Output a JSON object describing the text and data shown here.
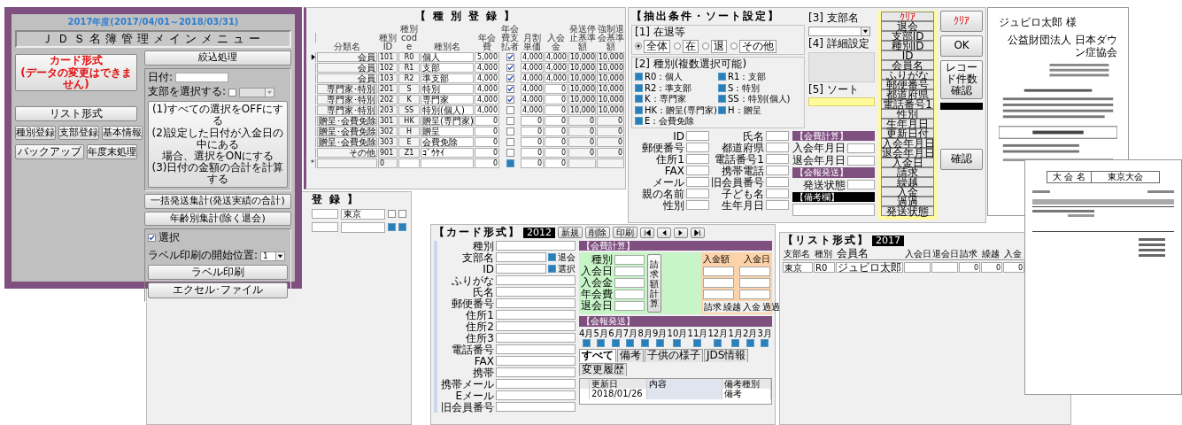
{
  "main_menu": {
    "fiscal_year": "2017年度(2017/04/01～2018/03/31)",
    "title": "ＪＤＳ名簿管理メインメニュー",
    "card_button": [
      "カード形式",
      "(データの変更はできません)"
    ],
    "list_button": "リスト形式",
    "buttons_row1": [
      "種別登録",
      "支部登録",
      "基本情報"
    ],
    "buttons_row2": [
      "バックアップ",
      "年度末処理"
    ],
    "filter_button": "絞込処理",
    "date_label": "日付:",
    "branch_label": "支部を選択する:",
    "branch_checked": false,
    "process_button": [
      "(1)すべての選択をOFFにする",
      "(2)設定した日付が入金日の中にある",
      "場合、選択をONにする",
      "(3)日付の金額の合計を計算する"
    ],
    "shipping_button": "一括発送集計(発送実績の合計)",
    "age_button": "年齢別集計(除く退会)",
    "select": {
      "label": "選択",
      "checked": true
    },
    "label_start": {
      "label": "ラベル印刷の開始位置:",
      "value": "1"
    },
    "label_print_button": "ラベル印刷",
    "excel_button": "エクセル･ファイル"
  },
  "category_form": {
    "title": "【 種 別 登 録 】",
    "columns": [
      "分類名",
      "種別ID",
      "種別code",
      "種別名",
      "年会費",
      "年会費支払者",
      "月割単価",
      "入会金",
      "発送停止基準額",
      "強制退会基準額"
    ],
    "rows": [
      {
        "selected": true,
        "group": "会員",
        "id": "101",
        "code": "R0",
        "name": "個人",
        "annual_fee": "5,000",
        "payer": true,
        "monthly": "4,000",
        "entry_fee": "4,000",
        "stop": "10,000",
        "force": "10,000"
      },
      {
        "selected": false,
        "group": "会員",
        "id": "102",
        "code": "R1",
        "name": "支部",
        "annual_fee": "4,000",
        "payer": true,
        "monthly": "4,000",
        "entry_fee": "4,000",
        "stop": "10,000",
        "force": "10,000"
      },
      {
        "selected": false,
        "group": "会員",
        "id": "103",
        "code": "R2",
        "name": "準支部",
        "annual_fee": "4,000",
        "payer": true,
        "monthly": "4,000",
        "entry_fee": "4,000",
        "stop": "10,000",
        "force": "10,000"
      },
      {
        "selected": false,
        "group": "専門家･特別",
        "id": "201",
        "code": "S",
        "name": "特別",
        "annual_fee": "4,000",
        "payer": true,
        "monthly": "4,000",
        "entry_fee": "0",
        "stop": "10,000",
        "force": "10,000"
      },
      {
        "selected": false,
        "group": "専門家･特別",
        "id": "202",
        "code": "K",
        "name": "専門家",
        "annual_fee": "4,000",
        "payer": true,
        "monthly": "4,000",
        "entry_fee": "0",
        "stop": "10,000",
        "force": "10,000"
      },
      {
        "selected": false,
        "group": "専門家･特別",
        "id": "203",
        "code": "SS",
        "name": "特別(個人)",
        "annual_fee": "4,000",
        "payer": false,
        "monthly": "4,000",
        "entry_fee": "0",
        "stop": "10,000",
        "force": "10,000"
      },
      {
        "selected": false,
        "group": "贈呈･会費免除",
        "id": "301",
        "code": "HK",
        "name": "贈呈(専門家)",
        "annual_fee": "0",
        "payer": false,
        "monthly": "0",
        "entry_fee": "0",
        "stop": "0",
        "force": "0"
      },
      {
        "selected": false,
        "group": "贈呈･会費免除",
        "id": "302",
        "code": "H",
        "name": "贈呈",
        "annual_fee": "0",
        "payer": false,
        "monthly": "0",
        "entry_fee": "0",
        "stop": "0",
        "force": "0"
      },
      {
        "selected": false,
        "group": "贈呈･会費免除",
        "id": "303",
        "code": "E",
        "name": "会費免除",
        "annual_fee": "0",
        "payer": false,
        "monthly": "0",
        "entry_fee": "0",
        "stop": "0",
        "force": "0"
      },
      {
        "selected": false,
        "group": "その他",
        "id": "901",
        "code": "Z1",
        "name": "ｺﾞｳｹｲ",
        "annual_fee": "0",
        "payer": false,
        "monthly": "0",
        "entry_fee": "0",
        "stop": "0",
        "force": "0"
      }
    ],
    "new_row": {
      "marker": "*",
      "id": "0",
      "annual_fee": "0",
      "payer": true,
      "monthly": "0",
      "entry_fee": "0"
    }
  },
  "branch_form": {
    "title": "登 録 】",
    "rows": [
      {
        "name": "東京",
        "flag_a": false,
        "flag_b": false
      },
      {
        "flag_a": true,
        "flag_b": true
      }
    ]
  },
  "extract": {
    "title": "【抽出条件・ソート設定】",
    "status": {
      "label": "[1] 在退等",
      "options": [
        {
          "label": "全体",
          "selected": true
        },
        {
          "label": "在",
          "selected": false
        },
        {
          "label": "退",
          "selected": false
        },
        {
          "label": "その他",
          "selected": false
        }
      ]
    },
    "types": {
      "label": "[2] 種別(複数選択可能)",
      "items": [
        {
          "label": "R0：個人",
          "checked": true
        },
        {
          "label": "R1：支部",
          "checked": true
        },
        {
          "label": "R2：準支部",
          "checked": true
        },
        {
          "label": "S：特別",
          "checked": true
        },
        {
          "label": "K：専門家",
          "checked": true
        },
        {
          "label": "SS：特別(個人)",
          "checked": true
        },
        {
          "label": "HK：贈呈(専門家)",
          "checked": true
        },
        {
          "label": "H：贈呈",
          "checked": true
        },
        {
          "label": "E：会費免除",
          "checked": true
        }
      ]
    },
    "branch_label": "[3] 支部名",
    "detail_label": "[4] 詳細設定",
    "sort_label": "[5] ソート",
    "clear_button": "ｸﾘｱ",
    "ok_button": "OK",
    "count_button": "レコード件数確認",
    "confirm_button": "確認",
    "sort_buttons": [
      "ｸﾘｱ",
      "退会",
      "支部ID",
      "種別ID",
      "ID",
      "会員名",
      "ふりがな",
      "郵便番号",
      "都道府県",
      "電話番号1",
      "性別",
      "生年月日",
      "更新日付",
      "入会年月日",
      "退会年月日",
      "入金日",
      "請求",
      "繰越",
      "入金",
      "過過",
      "発送状態"
    ],
    "fields": [
      "ID",
      "氏名",
      "郵便番号",
      "都道府県",
      "住所1",
      "電話番号1",
      "FAX",
      "携帯電話",
      "メール",
      "旧会員番号",
      "親の名前",
      "子ども名",
      "性別",
      "生年月日"
    ],
    "fee_header": "【会費計算】",
    "fee_labels": [
      "入会年月日",
      "退会年月日"
    ],
    "mail_header": "【会報発送】",
    "mail_labels": [
      "発送状態"
    ],
    "note_header": "【備考欄】"
  },
  "card": {
    "title": "【カード形式】",
    "year": "2012",
    "buttons": [
      "新規",
      "削除",
      "印刷"
    ],
    "fields": [
      "種別",
      "支部名",
      "ID",
      "ふりがな",
      "氏名",
      "郵便番号",
      "住所1",
      "住所2",
      "住所3",
      "電話番号",
      "FAX",
      "携帯",
      "携帯メール",
      "Eメール",
      "旧会員番号"
    ],
    "withdrawn": {
      "label": "退会",
      "checked": true
    },
    "id_select": {
      "label": "選択",
      "checked": true
    },
    "fee_header": "【会費計算】",
    "fee_labels": [
      "種別",
      "入会日",
      "入会金",
      "年会費",
      "退会日"
    ],
    "calc_button": "請求額計算",
    "payment_labels": [
      "入金額",
      "入金日"
    ],
    "balance_labels": [
      "請求",
      "繰越",
      "入金",
      "過過"
    ],
    "mail_header": "【会報発送】",
    "months": [
      {
        "label": "4月",
        "checked": true
      },
      {
        "label": "5月",
        "checked": true
      },
      {
        "label": "6月",
        "checked": true
      },
      {
        "label": "7月",
        "checked": true
      },
      {
        "label": "8月",
        "checked": true
      },
      {
        "label": "9月",
        "checked": true
      },
      {
        "label": "10月",
        "checked": true
      },
      {
        "label": "11月",
        "checked": true
      },
      {
        "label": "12月",
        "checked": true
      },
      {
        "label": "1月",
        "checked": true
      },
      {
        "label": "2月",
        "checked": true
      },
      {
        "label": "3月",
        "checked": true
      }
    ],
    "tabs": [
      {
        "label": "すべて",
        "selected": true
      },
      {
        "label": "備考",
        "selected": false
      },
      {
        "label": "子供の様子",
        "selected": false
      },
      {
        "label": "JDS情報",
        "selected": false
      },
      {
        "label": "変更履歴",
        "selected": false
      }
    ],
    "grid": {
      "columns": [
        "更新日",
        "内容",
        "備考種別"
      ],
      "rows": [
        {
          "date": "2018/01/26",
          "note_type": "備考"
        }
      ]
    }
  },
  "list": {
    "title": "【リスト形式】",
    "year": "2017",
    "columns": [
      "支部名",
      "種別",
      "会員名",
      "入会日",
      "退会日",
      "請求",
      "繰越",
      "入金"
    ],
    "rows": [
      {
        "branch": "東京",
        "type": "R0",
        "name": "ジュビロ太郎",
        "values": [
          "0",
          "0",
          "0"
        ]
      }
    ]
  },
  "letter": {
    "recipient": "ジュビロ太郎 様",
    "sender": "公益財団法人 日本ダウン症協会"
  },
  "report": {
    "event_label": "大 会 名",
    "event_value": "東京大会"
  }
}
